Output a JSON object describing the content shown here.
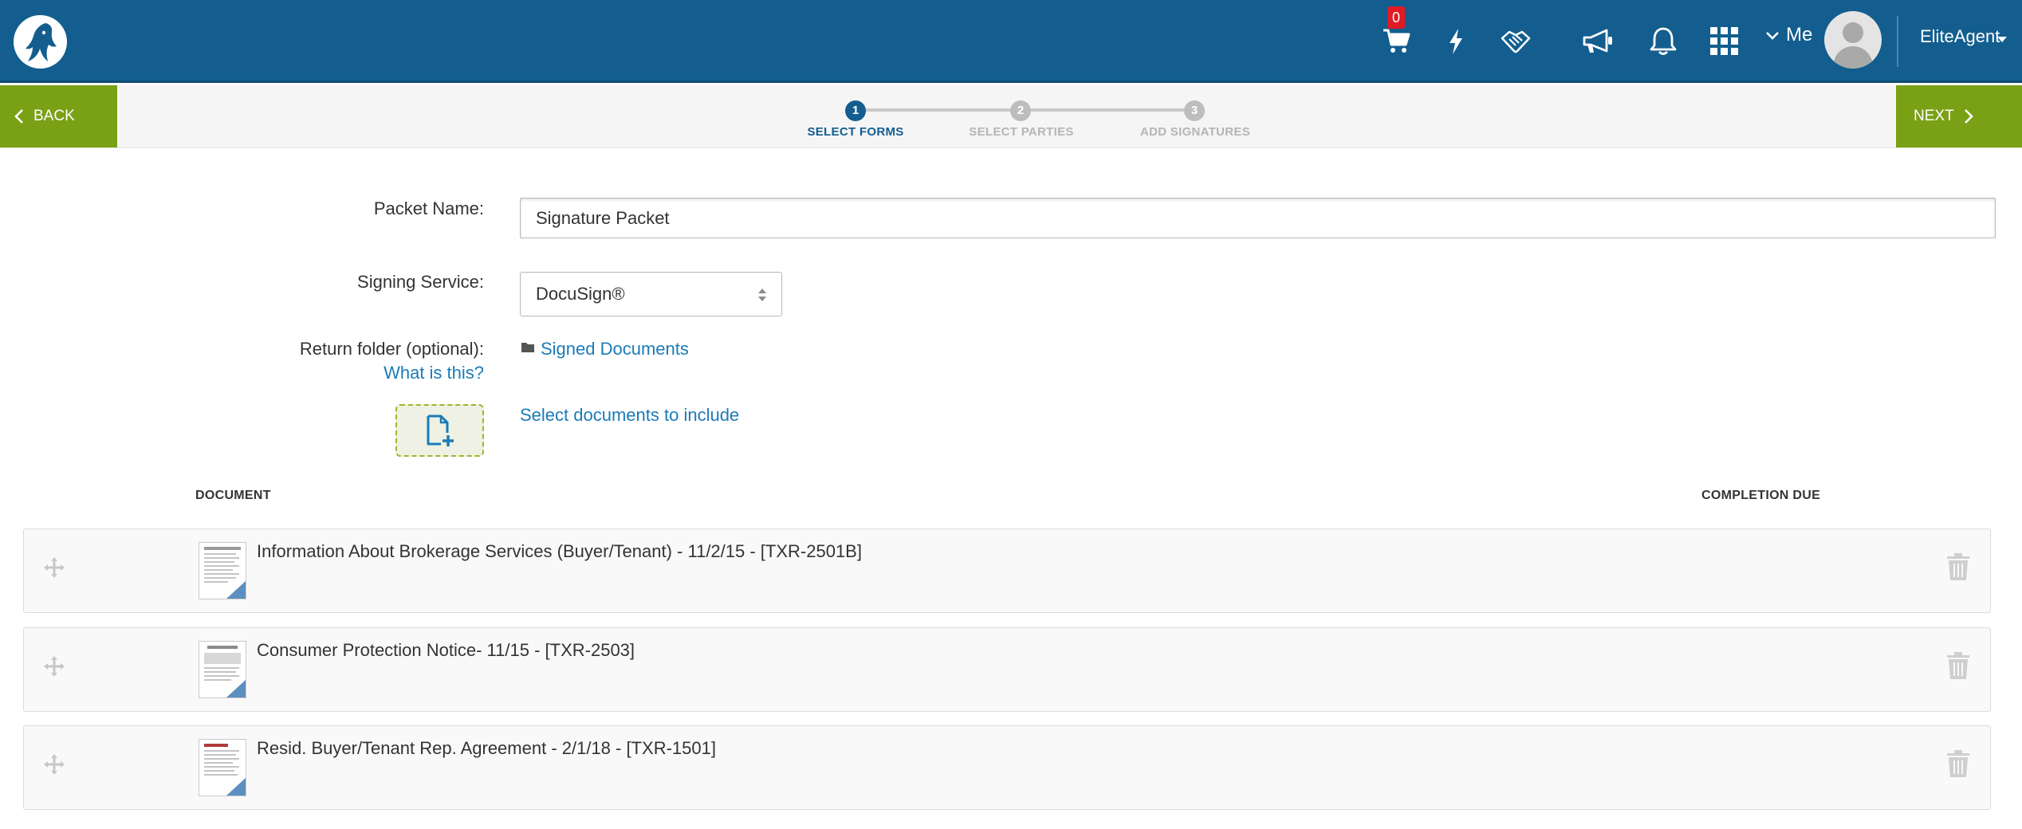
{
  "header": {
    "cart_count": "0",
    "me_label": "Me",
    "user_name": "EliteAgent"
  },
  "wizard": {
    "back_label": "BACK",
    "next_label": "NEXT",
    "steps": [
      {
        "number": "1",
        "label": "SELECT FORMS",
        "active": true
      },
      {
        "number": "2",
        "label": "SELECT PARTIES",
        "active": false
      },
      {
        "number": "3",
        "label": "ADD SIGNATURES",
        "active": false
      }
    ]
  },
  "form": {
    "packet_name_label": "Packet Name:",
    "packet_name_value": "Signature Packet",
    "signing_service_label": "Signing Service:",
    "signing_service_value": "DocuSign®",
    "return_folder_label": "Return folder (optional):",
    "what_is_this": "What is this?",
    "return_folder_value": "Signed Documents",
    "select_documents": "Select documents to include"
  },
  "table": {
    "col_document": "DOCUMENT",
    "col_completion_due": "COMPLETION DUE",
    "rows": [
      {
        "title": "Information About Brokerage Services (Buyer/Tenant) - 11/2/15 - [TXR-2501B]"
      },
      {
        "title": "Consumer Protection Notice- 11/15 - [TXR-2503]"
      },
      {
        "title": "Resid. Buyer/Tenant Rep. Agreement - 2/1/18 - [TXR-1501]"
      }
    ]
  },
  "icons": {
    "logo": "wolf-head-logo-icon",
    "cart": "shopping-cart-icon",
    "bolt": "lightning-bolt-icon",
    "handshake": "handshake-icon",
    "megaphone": "megaphone-icon",
    "bell": "bell-icon",
    "apps": "apps-grid-icon",
    "drag": "move-arrows-icon",
    "trash": "trash-icon",
    "folder": "folder-icon",
    "add_document": "add-document-icon"
  },
  "colors": {
    "header_blue": "#135e8e",
    "action_green": "#7aa015",
    "link_blue": "#1b7bb8",
    "badge_red": "#e01b24"
  }
}
